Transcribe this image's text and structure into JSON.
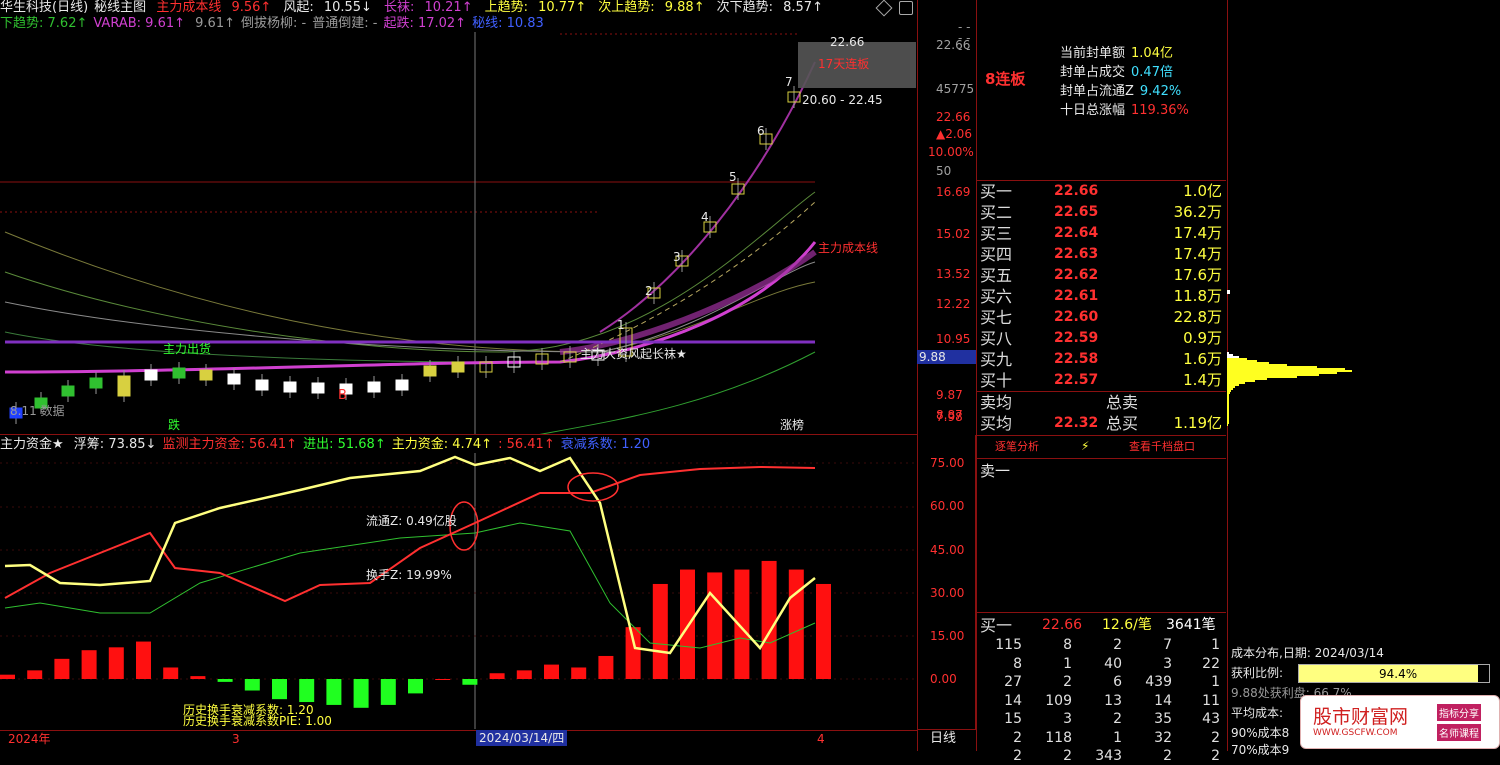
{
  "top_legend": {
    "title": "华生科技(日线)",
    "mode": "秘线主图",
    "items": [
      {
        "label": "主力成本线",
        "value": "9.56↑",
        "color": "#ff3030"
      },
      {
        "label": "风起:",
        "value": "10.55↓",
        "color": "#e8e8e8"
      },
      {
        "label": "长袜:",
        "value": "10.21↑",
        "color": "#d040d0"
      },
      {
        "label": "上趋势:",
        "value": "10.77↑",
        "color": "#ffff40"
      },
      {
        "label": "次上趋势:",
        "value": "9.88↑",
        "color": "#ffff40"
      },
      {
        "label": "次下趋势:",
        "value": "8.57↑",
        "color": "#e8e8e8"
      }
    ],
    "line2": [
      {
        "label": "下趋势:",
        "value": "7.62↑",
        "color": "#30c030"
      },
      {
        "label": "VARAB:",
        "value": "9.61↑",
        "color": "#d040d0"
      },
      {
        "label": "",
        "value": "9.61↑",
        "color": "#9a9a9a"
      },
      {
        "label": "倒拔杨柳:",
        "value": "-",
        "color": "#9a9a9a"
      },
      {
        "label": "普通倒建:",
        "value": "-",
        "color": "#9a9a9a"
      },
      {
        "label": "起跌:",
        "value": "17.02↑",
        "color": "#d040d0"
      },
      {
        "label": "秘线:",
        "value": "10.83",
        "color": "#4060ff"
      }
    ]
  },
  "main_chart": {
    "price_axis": [
      "22.66",
      "45775",
      "22.66",
      "▲2.06",
      "10.00%",
      "50",
      "16.69",
      "15.02",
      "13.52",
      "12.22",
      "10.95",
      "9.88",
      "9.87",
      "8.87",
      "7.98"
    ],
    "annotations": {
      "top_price": "22.66",
      "streak_label": "17天连板",
      "range_label": "20.60 - 22.45",
      "cost_line_label": "主力成本线",
      "main_out_label": "主力出货",
      "signal_label": "主力大资风起长袜★",
      "data_label": "8.11 数据",
      "b_mark": "B",
      "down_mark": "跌",
      "limit_mark": "涨榜",
      "wave_numbers": [
        "1",
        "2",
        "3",
        "4",
        "5",
        "6",
        "7"
      ],
      "current_price": "9.88"
    }
  },
  "sub_legend": {
    "items": [
      {
        "label": "主力资金★",
        "value": "",
        "color": "#e8e8e8"
      },
      {
        "label": "浮筹:",
        "value": "73.85↓",
        "color": "#e8e8e8"
      },
      {
        "label": "监测主力资金:",
        "value": "56.41↑",
        "color": "#ff3030"
      },
      {
        "label": "进出:",
        "value": "51.68↑",
        "color": "#30ff30"
      },
      {
        "label": "主力资金:",
        "value": "4.74↑",
        "color": "#ffff40"
      },
      {
        "label": ":",
        "value": "56.41↑",
        "color": "#ff3030"
      },
      {
        "label": "衰减系数:",
        "value": "1.20",
        "color": "#4060ff"
      }
    ],
    "axis": [
      "75.00",
      "60.00",
      "45.00",
      "30.00",
      "15.00",
      "0.00"
    ],
    "float_label": "流通Z: 0.49亿股",
    "turnover_label": "换手Z: 19.99%",
    "hist1": "历史换手衰减系数: 1.20",
    "hist2": "历史换手衰减系数PIE: 1.00"
  },
  "bottom_axis": {
    "year": "2024年",
    "m3": "3",
    "date": "2024/03/14/四",
    "m4": "4",
    "period": "日线"
  },
  "right_panel": {
    "limit_title": "8连板",
    "seal": [
      {
        "label": "当前封单额",
        "value": "1.04亿",
        "color": "#ffff40"
      },
      {
        "label": "封单占成交",
        "value": "0.47倍",
        "color": "#40e0ff"
      },
      {
        "label": "封单占流通Z",
        "value": "9.42%",
        "color": "#40e0ff"
      },
      {
        "label": "十日总涨幅",
        "value": "119.36%",
        "color": "#ff3030"
      }
    ],
    "bids": [
      {
        "lbl": "买一",
        "price": "22.66",
        "vol": "1.0亿"
      },
      {
        "lbl": "买二",
        "price": "22.65",
        "vol": "36.2万"
      },
      {
        "lbl": "买三",
        "price": "22.64",
        "vol": "17.4万"
      },
      {
        "lbl": "买四",
        "price": "22.63",
        "vol": "17.4万"
      },
      {
        "lbl": "买五",
        "price": "22.62",
        "vol": "17.6万"
      },
      {
        "lbl": "买六",
        "price": "22.61",
        "vol": "11.8万"
      },
      {
        "lbl": "买七",
        "price": "22.60",
        "vol": "22.8万"
      },
      {
        "lbl": "买八",
        "price": "22.59",
        "vol": "0.9万"
      },
      {
        "lbl": "买九",
        "price": "22.58",
        "vol": "1.6万"
      },
      {
        "lbl": "买十",
        "price": "22.57",
        "vol": "1.4万"
      }
    ],
    "avg_sell_label": "卖均",
    "total_sell_label": "总卖",
    "avg_buy_label": "买均",
    "avg_buy": "22.32",
    "total_buy_label": "总买",
    "total_buy": "1.19亿",
    "tabs": [
      "逐笔分析",
      "⚡",
      "查看千档盘口"
    ],
    "sell1": "卖一",
    "deal_head": {
      "lbl": "买一",
      "price": "22.66",
      "per": "12.6/笔",
      "count": "3641笔"
    },
    "deal_rows": [
      [
        "115",
        "8",
        "2",
        "7",
        "1"
      ],
      [
        "8",
        "1",
        "40",
        "3",
        "22"
      ],
      [
        "27",
        "2",
        "6",
        "439",
        "1"
      ],
      [
        "14",
        "109",
        "13",
        "14",
        "11"
      ],
      [
        "15",
        "3",
        "2",
        "35",
        "43"
      ],
      [
        "2",
        "118",
        "1",
        "32",
        "2"
      ],
      [
        "2",
        "2",
        "343",
        "2",
        "2"
      ]
    ],
    "cost": {
      "title": "成本分布,日期: 2024/03/14",
      "profit_label": "获利比例:",
      "profit_value": "94.4%",
      "profit_ratio": 0.944,
      "line1": "9.88处获利盘: 66.7%",
      "line2": "平均成本:",
      "line3": "90%成本8",
      "line4": "70%成本9"
    }
  },
  "watermark": {
    "title": "股市财富网",
    "sub": "WWW.GSCFW.COM",
    "tag1": "指标分享",
    "tag2": "名师课程"
  },
  "chart_data": [
    {
      "type": "bar",
      "title": "",
      "series": [
        {
          "values": [
            1.5,
            3,
            7,
            10,
            11,
            13,
            4,
            1,
            -1,
            -4,
            -7,
            -8,
            -9,
            -10,
            -9,
            -5,
            0,
            -2,
            2,
            3,
            5,
            4,
            8,
            18,
            33,
            38,
            37,
            38,
            41,
            38,
            33
          ]
        }
      ],
      "ylim": [
        0,
        75
      ]
    }
  ]
}
